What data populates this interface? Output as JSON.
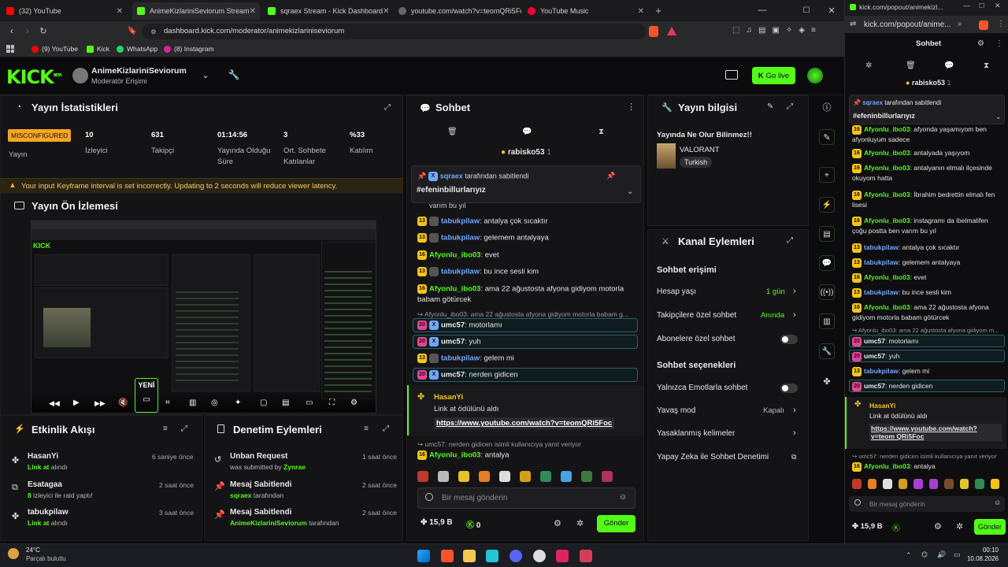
{
  "browser": {
    "tabs": [
      {
        "label": "(32) YouTube",
        "color": "#ff0000"
      },
      {
        "label": "AnimeKizlariniSeviorum Stream",
        "color": "#53fc18"
      },
      {
        "label": "sqraex Stream - Kick Dashboard",
        "color": "#53fc18"
      },
      {
        "label": "youtube.com/watch?v=teomQRi5Foc",
        "color": "#888888"
      },
      {
        "label": "YouTube Music",
        "color": "#ff0033"
      }
    ],
    "url": "dashboard.kick.com/moderator/animekizlariniseviorum",
    "bookmarks": [
      "(9) YouTube",
      "Kick",
      "WhatsApp",
      "(8) Instagram"
    ]
  },
  "header": {
    "logo": "KICK",
    "logo_sup": "BETA",
    "channel_name": "AnimeKizlariniSeviorum",
    "role": "Moderatör Erişimi",
    "go_live": "Go live"
  },
  "stats": {
    "title": "Yayın İstatistikleri",
    "status_badge": "MISCONFIGURED",
    "status_label": "Yayın",
    "items": [
      {
        "value": "10",
        "label": "İzleyici"
      },
      {
        "value": "631",
        "label": "Takipçi"
      },
      {
        "value": "01:14:56",
        "label": "Yayında Olduğu Süre"
      },
      {
        "value": "3",
        "label": "Ort. Sohbete Katılanlar"
      },
      {
        "value": "%33",
        "label": "Katılım"
      }
    ],
    "warning": "Your input Keyframe interval is set incorrectly. Updating to 2 seconds will reduce viewer latency."
  },
  "preview": {
    "title": "Yayın Ön İzlemesi",
    "new_label": "YENİ"
  },
  "activity": {
    "title": "Etkinlik Akışı",
    "items": [
      {
        "user": "HasanYi",
        "action_bold": "Link at",
        "action": "alındı",
        "time": "6 saniye önce"
      },
      {
        "user": "Esatagaa",
        "action_bold": "8",
        "action": "izleyici ile raid yaptı!",
        "time": "2 saat önce"
      },
      {
        "user": "tabukpilaw",
        "action_bold": "Link at",
        "action": "alındı",
        "time": "3 saat önce"
      }
    ]
  },
  "modlog": {
    "title": "Denetim Eylemleri",
    "items": [
      {
        "title": "Unban Request",
        "pre": "was submitted by",
        "user": "Zynrae",
        "post": "",
        "time": "1 saat önce"
      },
      {
        "title": "Mesaj Sabitlendi",
        "pre": "",
        "user": "sqraex",
        "post": "tarafından",
        "time": "2 saat önce"
      },
      {
        "title": "Mesaj Sabitlendi",
        "pre": "",
        "user": "AnimeKizlariniSeviorum",
        "post": "tarafından",
        "time": "2 saat önce"
      }
    ]
  },
  "chat": {
    "title": "Sohbet",
    "top_user": "rabisko53",
    "top_count": "1",
    "pinned_by": "sqraex",
    "pinned_by_suffix": "tarafından sabitlendi",
    "pinned_text": "#efeninbillurlarıyız",
    "cut_text": "varım bu yıl",
    "messages": [
      {
        "user": "tabukpilaw",
        "text": ": antalya çok sıcaktır",
        "type": "x"
      },
      {
        "user": "tabukpilaw",
        "text": ": gelemem antalyaya",
        "type": "x"
      },
      {
        "user": "Afyonlu_ibo03",
        "text": ": evet",
        "type": "g"
      },
      {
        "user": "tabukpilaw",
        "text": ": bu ince sesli kim",
        "type": "x"
      },
      {
        "user": "Afyonlu_ibo03",
        "text": ": ama 22 ağustosta afyona gidiyom motorla",
        "type": "g"
      },
      {
        "user": "",
        "text": "babam götürcek",
        "type": "cont"
      }
    ],
    "reply1": "Afyonlu_ibo03: ama 22 ağustosta afyona gidiyom motorla babam g...",
    "messages2": [
      {
        "user": "umc57",
        "text": ": motorlamı",
        "hl": true
      },
      {
        "user": "umc57",
        "text": ": yuh",
        "hl": true
      },
      {
        "user": "tabukpilaw",
        "text": ": gelem mi",
        "hl": false
      },
      {
        "user": "umc57",
        "text": ": nerden gidicen",
        "hl": true
      }
    ],
    "redeem_user": "HasanYi",
    "redeem_text": "Link at ödülünü aldı",
    "redeem_link": "https://www.youtube.com/watch?v=teomQRi5Foc",
    "reply2": "umc57: nerden gidicen isimli kullanıcıya yanıt veriyor",
    "last_user": "Afyonlu_ibo03",
    "last_text": ": antalya",
    "input_placeholder": "Bir mesaj gönderin",
    "points": "15,9 B",
    "kick_points": "0",
    "send": "Gönder"
  },
  "info": {
    "title": "Yayın bilgisi",
    "stream_title": "Yayında Ne Olur Bilinmez!!",
    "category": "VALORANT",
    "tag": "Turkish"
  },
  "channel_actions": {
    "title": "Kanal Eylemleri",
    "chat_access": "Sohbet erişimi",
    "rows": [
      {
        "label": "Hesap yaşı",
        "value": "1 gün"
      },
      {
        "label": "Takipçilere özel sohbet",
        "value": "Anında"
      },
      {
        "label": "Abonelere özel sohbet",
        "value": ""
      }
    ],
    "chat_options": "Sohbet seçenekleri",
    "rows2": [
      {
        "label": "Yalnızca Emotlarla sohbet",
        "value": ""
      },
      {
        "label": "Yavaş mod",
        "value": "Kapalı"
      },
      {
        "label": "Yasaklanmış kelimeler",
        "value": ""
      },
      {
        "label": "Yapay Zeka ile Sohbet Denetimi",
        "value": ""
      }
    ]
  },
  "popout": {
    "url": "kick.com/popout/animekizl...",
    "url2": "kick.com/popout/anime...",
    "title": "Sohbet",
    "top_user": "rabisko53",
    "top_count": "1",
    "pinned_by": "sqraex",
    "pinned_by_suffix": "tarafından sabitlendi",
    "pinned_text": "#efeninbillurlarıyız",
    "lines": [
      {
        "user": "Afyonlu_ibo03",
        "text": ": afyonda yaşamıyom ben afyonluyum sadece",
        "type": "g"
      },
      {
        "user": "Afyonlu_ibo03",
        "text": ": antalyada yaşıyom",
        "type": "g"
      },
      {
        "user": "Afyonlu_ibo03",
        "text": ": antalyanın elmalı ilçesinde okuyom hatta",
        "type": "g"
      },
      {
        "user": "Afyonlu_ibo03",
        "text": ": İbrahim bedrettin elmalı fen lisesi",
        "type": "g"
      },
      {
        "user": "Afyonlu_ibo03",
        "text": ": instagramı da ibelmalifen çoğu postta ben varım bu yıl",
        "type": "g"
      },
      {
        "user": "tabukpilaw",
        "text": ": antalya çok sıcaktır",
        "type": "x"
      },
      {
        "user": "tabukpilaw",
        "text": ": gelemem antalyaya",
        "type": "x"
      },
      {
        "user": "Afyonlu_ibo03",
        "text": ": evet",
        "type": "g"
      },
      {
        "user": "tabukpilaw",
        "text": ": bu ince sesli kim",
        "type": "x"
      },
      {
        "user": "Afyonlu_ibo03",
        "text": ": ama 22 ağustosta afyona gidiyom motorla babam götürcek",
        "type": "g"
      }
    ],
    "reply1": "Afyonlu_ibo03: ama 22 ağustosta afyona gidiyom m...",
    "lines2": [
      {
        "user": "umc57",
        "text": ": motorlamı"
      },
      {
        "user": "umc57",
        "text": ": yuh"
      },
      {
        "user": "tabukpilaw",
        "text": ": gelem mi"
      },
      {
        "user": "umc57",
        "text": ": nerden gidicen"
      }
    ],
    "redeem_user": "HasanYi",
    "redeem_text": "Link at ödülünü aldı",
    "redeem_link": "https://www.youtube.com/watch?v=teom QRi5Foc",
    "reply2": "umc57: nerden gidicen isimli kullanıcıya yanıt veriyor",
    "last_user": "Afyonlu_ibo03",
    "last_text": ": antalya",
    "input_placeholder": "Bir mesaj gönderin",
    "points": "15,9 B",
    "send": "Gönder"
  },
  "taskbar": {
    "temp": "24°C",
    "weather": "Parçalı bulutlu",
    "time": "00:10",
    "date": "10.08.2026"
  },
  "colors": {
    "accent": "#53fc18",
    "link": "#6fa8ff",
    "bg": "#0b0b0d"
  }
}
